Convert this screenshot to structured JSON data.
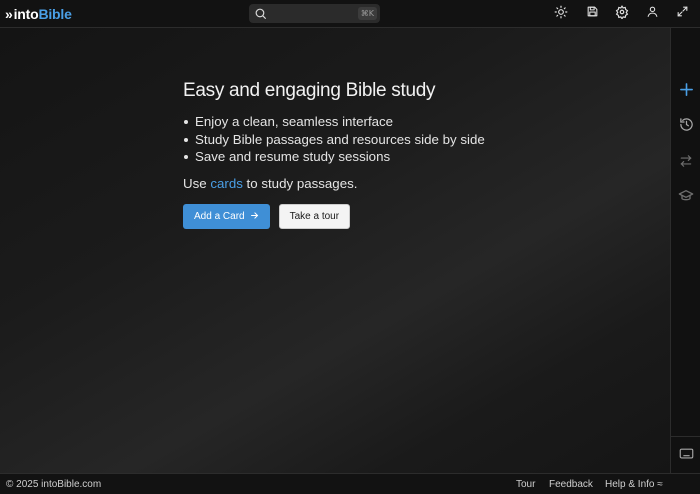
{
  "header": {
    "logo_chevrons": "»",
    "logo_into": "into",
    "logo_bible": "Bible",
    "search_shortcut": "⌘K",
    "icons": [
      "theme-sun-icon",
      "save-icon",
      "settings-gear-icon",
      "user-icon",
      "expand-icon"
    ]
  },
  "main": {
    "heading": "Easy and engaging Bible study",
    "features": [
      "Enjoy a clean, seamless interface",
      "Study Bible passages and resources side by side",
      "Save and resume study sessions"
    ],
    "use_prefix": "Use ",
    "use_link": "cards",
    "use_suffix": " to study passages.",
    "add_card_label": "Add a Card",
    "tour_label": "Take a tour"
  },
  "rail": {
    "icons": [
      "plus-icon",
      "history-icon",
      "swap-icon",
      "graduation-cap-icon",
      "keyboard-icon"
    ]
  },
  "footer": {
    "copyright": "© 2025 intoBible.com",
    "tour": "Tour",
    "feedback": "Feedback",
    "help": "Help & Info ≈"
  },
  "colors": {
    "accent": "#4a9fe6",
    "primary_button": "#3f8fd6",
    "background": "#141414"
  }
}
